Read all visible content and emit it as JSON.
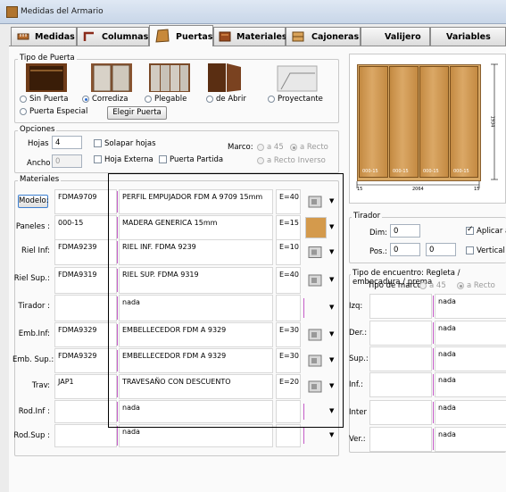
{
  "window": {
    "title": "Medidas del Armario"
  },
  "tabs": [
    {
      "label": "Medidas",
      "icon": "ruler-icon"
    },
    {
      "label": "Columnas",
      "icon": "column-icon"
    },
    {
      "label": "Puertas",
      "icon": "door-icon",
      "active": true
    },
    {
      "label": "Materiales",
      "icon": "materials-icon"
    },
    {
      "label": "Cajoneras",
      "icon": "drawer-icon"
    },
    {
      "label": "Valijero",
      "icon": ""
    },
    {
      "label": "Variables",
      "icon": ""
    }
  ],
  "tipo_puerta": {
    "title": "Tipo de Puerta",
    "options": [
      "Sin Puerta",
      "Corrediza",
      "Plegable",
      "de Abrir",
      "Proyectante",
      "Puerta Especial"
    ],
    "selected": "Corrediza",
    "elegir_button": "Elegir Puerta"
  },
  "opciones": {
    "title": "Opciones",
    "hojas_label": "Hojas :",
    "hojas_value": "4",
    "ancho_label": "Ancho :",
    "ancho_value": "0",
    "solapar_label": "Solapar hojas",
    "externa_label": "Hoja Externa",
    "partida_label": "Puerta Partida",
    "marco_label": "Marco:",
    "marco_options": [
      "a 45",
      "a Recto",
      "a Recto Inverso"
    ],
    "marco_selected": "a Recto"
  },
  "materiales": {
    "title": "Materiales",
    "rows": [
      {
        "label": "Modelo:",
        "is_button": true,
        "code": "FDMA9709",
        "desc": "PERFIL EMPUJADOR FDM A 9709 15mm",
        "e": "E=40",
        "thumb": "profile-icon"
      },
      {
        "label": "Paneles :",
        "code": "000-15",
        "desc": "MADERA GENERICA 15mm",
        "e": "E=15",
        "thumb": "wood-panel-icon"
      },
      {
        "label": "Riel Inf:",
        "code": "FDMA9239",
        "desc": "RIEL INF. FDMA 9239",
        "e": "E=10",
        "thumb": "rail-icon"
      },
      {
        "label": "Riel Sup.:",
        "code": "FDMA9319",
        "desc": "RIEL SUP. FDMA 9319",
        "e": "E=40",
        "thumb": "rail-top-icon"
      },
      {
        "label": "Tirador :",
        "code": "",
        "desc": "nada",
        "e": "",
        "thumb": ""
      },
      {
        "label": "Emb.Inf:",
        "code": "FDMA9329",
        "desc": "EMBELLECEDOR FDM A 9329",
        "e": "E=30",
        "thumb": "trim-icon"
      },
      {
        "label": "Emb. Sup.:",
        "code": "FDMA9329",
        "desc": "EMBELLECEDOR FDM A 9329",
        "e": "E=30",
        "thumb": "trim-icon"
      },
      {
        "label": "Trav:",
        "code": "JAP1",
        "desc": "TRAVESAÑO CON DESCUENTO",
        "e": "E=20",
        "thumb": "crossbar-icon"
      },
      {
        "label": "Rod.Inf :",
        "code": "",
        "desc": "nada",
        "e": "",
        "thumb": ""
      },
      {
        "label": "Rod.Sup :",
        "code": "",
        "desc": "nada",
        "e": "",
        "thumb": ""
      }
    ]
  },
  "preview": {
    "door_labels": [
      "000-15",
      "000-15",
      "000-15",
      "000-15"
    ],
    "width_label": "2064",
    "left_small": "15",
    "right_small": "15",
    "height_label": "1934"
  },
  "tirador": {
    "title": "Tirador",
    "dim_label": "Dim:",
    "dim_value": "0",
    "pos_label": "Pos.:",
    "pos_value1": "0",
    "pos_value2": "0",
    "aplicar_label": "Aplicar a t",
    "vertical_label": "Vertical"
  },
  "encuentro": {
    "title": "Tipo de encuentro: Regleta / embocadura / prema",
    "marco_label": "Tipo de marco:",
    "options": [
      "a 45",
      "a Recto"
    ],
    "selected": "a Recto",
    "rows": [
      {
        "label": "Izq:",
        "value": "nada"
      },
      {
        "label": "Der.:",
        "value": "nada"
      },
      {
        "label": "Sup.:",
        "value": "nada"
      },
      {
        "label": "Inf.:",
        "value": "nada"
      },
      {
        "label": "Inter",
        "value": "nada"
      },
      {
        "label": "Ver.:",
        "value": "nada"
      }
    ]
  }
}
